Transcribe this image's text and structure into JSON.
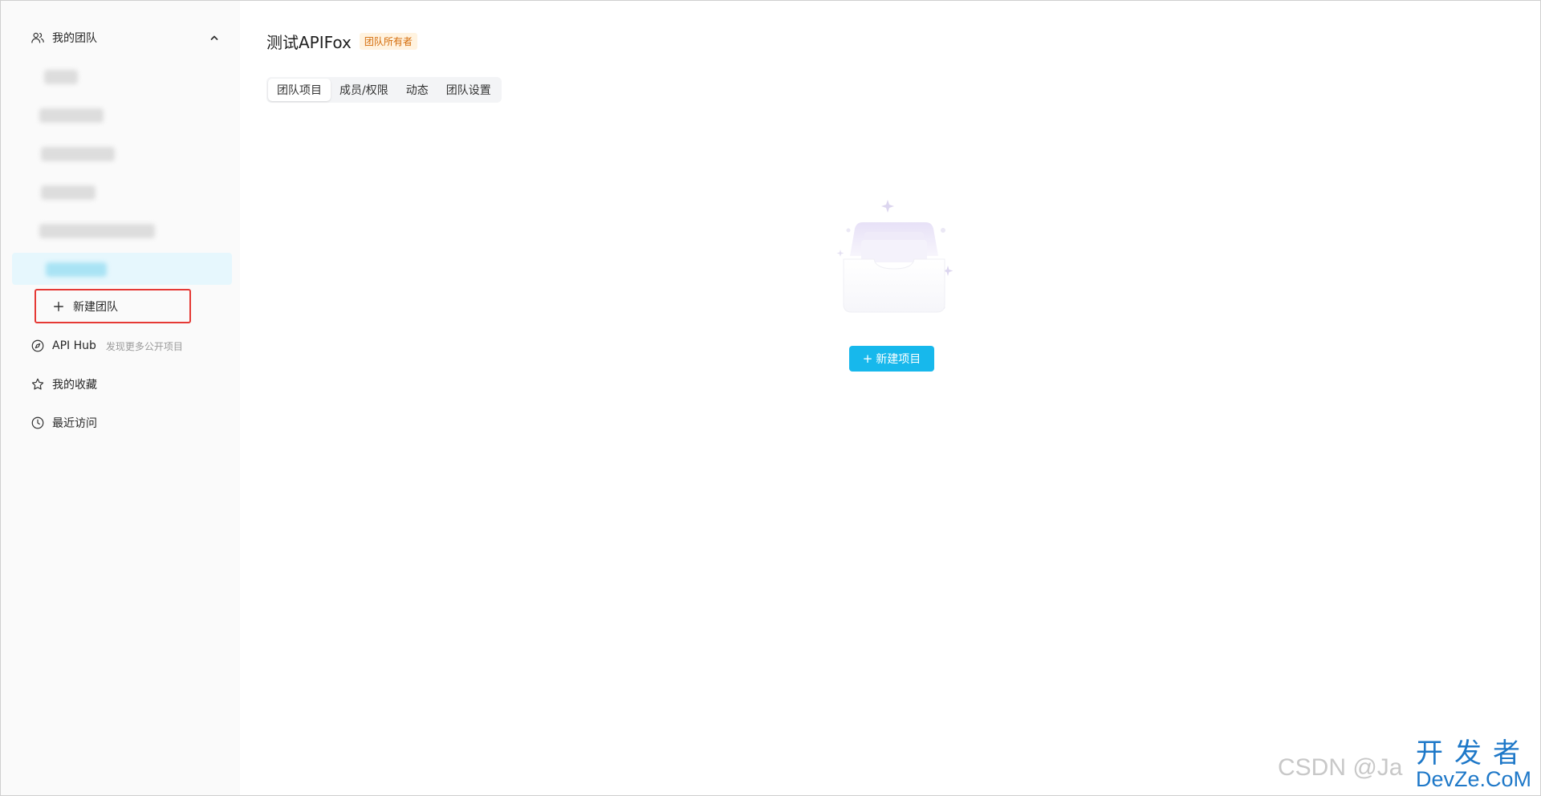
{
  "sidebar": {
    "team_header_label": "我的团队",
    "team_items": [
      {
        "blurred": true
      },
      {
        "blurred": true
      },
      {
        "blurred": true
      },
      {
        "blurred": true
      },
      {
        "blurred": true
      },
      {
        "blurred": true,
        "active": true
      }
    ],
    "new_team_label": "新建团队",
    "hub_label": "API Hub",
    "hub_sub": "发现更多公开项目",
    "favorites_label": "我的收藏",
    "recent_label": "最近访问"
  },
  "main": {
    "title": "测试APIFox",
    "owner_badge": "团队所有者",
    "tabs": [
      {
        "label": "团队项目",
        "active": true
      },
      {
        "label": "成员/权限"
      },
      {
        "label": "动态"
      },
      {
        "label": "团队设置"
      }
    ],
    "create_project_label": "新建项目"
  },
  "watermark": {
    "csdn": "CSDN @Ja",
    "dev_cn": "开发者",
    "dev_en": "DevZe.CoM"
  },
  "colors": {
    "accent": "#17b8ec",
    "active_bg": "#e6f7fd",
    "badge_text": "#d46b08",
    "badge_bg": "#fff3e0",
    "highlight_border": "#e53935"
  }
}
